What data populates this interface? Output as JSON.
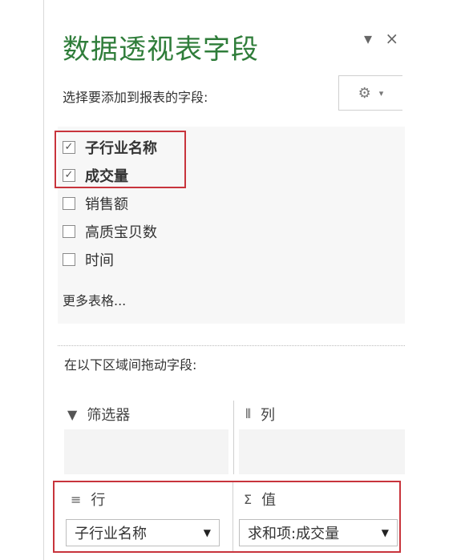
{
  "panel": {
    "title": "数据透视表字段",
    "subtitle": "选择要添加到报表的字段:",
    "controls": {
      "dropdown_icon": "▾",
      "close_icon": "×"
    },
    "gear_icon": "⚙",
    "gear_caret": "▾"
  },
  "fields": [
    {
      "label": "子行业名称",
      "checked": true,
      "check_mark": "✓"
    },
    {
      "label": "成交量",
      "checked": true,
      "check_mark": "✓"
    },
    {
      "label": "销售额",
      "checked": false,
      "check_mark": ""
    },
    {
      "label": "高质宝贝数",
      "checked": false,
      "check_mark": ""
    },
    {
      "label": "时间",
      "checked": false,
      "check_mark": ""
    }
  ],
  "more_tables": "更多表格...",
  "drag_label": "在以下区域间拖动字段:",
  "areas": {
    "filters": {
      "icon": "▼",
      "label": "筛选器"
    },
    "columns": {
      "icon": "⦀",
      "label": "列"
    },
    "rows": {
      "icon": "≡",
      "label": "行",
      "value": "子行业名称",
      "arrow": "▼"
    },
    "values": {
      "icon": "Σ",
      "label": "值",
      "value": "求和项:成交量",
      "arrow": "▼"
    }
  },
  "colors": {
    "title": "#2f7d3a",
    "highlight": "#c8343c"
  }
}
